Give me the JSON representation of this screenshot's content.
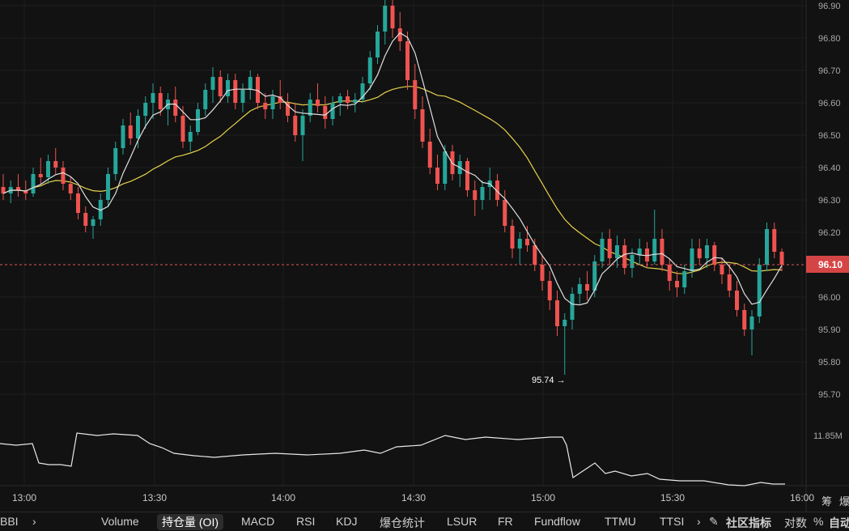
{
  "chart_data": {
    "type": "candlestick",
    "price_axis_ticks": [
      "96.90",
      "96.80",
      "96.70",
      "96.60",
      "96.50",
      "96.40",
      "96.30",
      "96.20",
      "96.00",
      "95.90",
      "95.80",
      "95.70"
    ],
    "current_price_label": "96.10",
    "current_price": 96.1,
    "low_marker_label": "95.74 →",
    "low_price": 95.74,
    "oi_axis_label": "11.85M",
    "time_ticks": [
      "13:00",
      "13:30",
      "14:00",
      "14:30",
      "15:00",
      "15:30",
      "16:00"
    ],
    "colors": {
      "up": "#26a69a",
      "down": "#ef5350",
      "ma_fast": "#e0e0e0",
      "ma_slow": "#e6d24c",
      "price_line": "#e05555"
    },
    "candles": [
      [
        96.34,
        96.38,
        96.3,
        96.32
      ],
      [
        96.32,
        96.36,
        96.29,
        96.34
      ],
      [
        96.34,
        96.38,
        96.31,
        96.33
      ],
      [
        96.33,
        96.36,
        96.3,
        96.32
      ],
      [
        96.32,
        96.4,
        96.31,
        96.38
      ],
      [
        96.38,
        96.43,
        96.35,
        96.37
      ],
      [
        96.37,
        96.44,
        96.35,
        96.42
      ],
      [
        96.42,
        96.46,
        96.38,
        96.4
      ],
      [
        96.4,
        96.42,
        96.33,
        96.35
      ],
      [
        96.35,
        96.37,
        96.3,
        96.32
      ],
      [
        96.32,
        96.34,
        96.24,
        96.26
      ],
      [
        96.26,
        96.28,
        96.2,
        96.22
      ],
      [
        96.22,
        96.25,
        96.18,
        96.24
      ],
      [
        96.24,
        96.32,
        96.22,
        96.3
      ],
      [
        96.3,
        96.4,
        96.28,
        96.38
      ],
      [
        96.38,
        96.48,
        96.36,
        96.46
      ],
      [
        96.46,
        96.55,
        96.44,
        96.53
      ],
      [
        96.53,
        96.57,
        96.47,
        96.49
      ],
      [
        96.49,
        96.58,
        96.46,
        96.56
      ],
      [
        96.56,
        96.62,
        96.52,
        96.6
      ],
      [
        96.6,
        96.66,
        96.55,
        96.63
      ],
      [
        96.63,
        96.65,
        96.56,
        96.58
      ],
      [
        96.58,
        96.63,
        96.53,
        96.61
      ],
      [
        96.61,
        96.65,
        96.54,
        96.56
      ],
      [
        96.56,
        96.59,
        96.46,
        96.48
      ],
      [
        96.48,
        96.53,
        96.45,
        96.51
      ],
      [
        96.51,
        96.6,
        96.5,
        96.58
      ],
      [
        96.58,
        96.66,
        96.56,
        96.64
      ],
      [
        96.64,
        96.71,
        96.6,
        96.68
      ],
      [
        96.68,
        96.7,
        96.6,
        96.62
      ],
      [
        96.62,
        96.69,
        96.6,
        96.67
      ],
      [
        96.67,
        96.69,
        96.58,
        96.6
      ],
      [
        96.6,
        96.66,
        96.57,
        96.64
      ],
      [
        96.64,
        96.7,
        96.61,
        96.68
      ],
      [
        96.68,
        96.69,
        96.58,
        96.6
      ],
      [
        96.6,
        96.63,
        96.55,
        96.58
      ],
      [
        96.58,
        96.64,
        96.55,
        96.62
      ],
      [
        96.62,
        96.67,
        96.58,
        96.6
      ],
      [
        96.6,
        96.63,
        96.54,
        96.56
      ],
      [
        96.56,
        96.6,
        96.48,
        96.5
      ],
      [
        96.5,
        96.58,
        96.42,
        96.56
      ],
      [
        96.56,
        96.63,
        96.54,
        96.61
      ],
      [
        96.61,
        96.66,
        96.57,
        96.59
      ],
      [
        96.59,
        96.62,
        96.52,
        96.55
      ],
      [
        96.55,
        96.62,
        96.53,
        96.6
      ],
      [
        96.6,
        96.63,
        96.56,
        96.62
      ],
      [
        96.62,
        96.64,
        96.58,
        96.6
      ],
      [
        96.6,
        96.63,
        96.57,
        96.61
      ],
      [
        96.61,
        96.68,
        96.6,
        96.66
      ],
      [
        96.66,
        96.76,
        96.64,
        96.74
      ],
      [
        96.74,
        96.84,
        96.72,
        96.82
      ],
      [
        96.82,
        96.94,
        96.78,
        96.9
      ],
      [
        96.9,
        96.93,
        96.8,
        96.83
      ],
      [
        96.83,
        96.88,
        96.76,
        96.79
      ],
      [
        96.79,
        96.82,
        96.64,
        96.67
      ],
      [
        96.67,
        96.72,
        96.55,
        96.58
      ],
      [
        96.58,
        96.62,
        96.46,
        96.48
      ],
      [
        96.48,
        96.52,
        96.38,
        96.4
      ],
      [
        96.4,
        96.44,
        96.33,
        96.35
      ],
      [
        96.35,
        96.47,
        96.33,
        96.45
      ],
      [
        96.45,
        96.47,
        96.36,
        96.38
      ],
      [
        96.38,
        96.44,
        96.34,
        96.42
      ],
      [
        96.42,
        96.43,
        96.31,
        96.33
      ],
      [
        96.33,
        96.36,
        96.25,
        96.3
      ],
      [
        96.3,
        96.36,
        96.27,
        96.34
      ],
      [
        96.34,
        96.4,
        96.3,
        96.36
      ],
      [
        96.36,
        96.38,
        96.28,
        96.3
      ],
      [
        96.3,
        96.33,
        96.2,
        96.22
      ],
      [
        96.22,
        96.24,
        96.12,
        96.15
      ],
      [
        96.15,
        96.2,
        96.1,
        96.18
      ],
      [
        96.18,
        96.22,
        96.14,
        96.16
      ],
      [
        96.16,
        96.18,
        96.08,
        96.1
      ],
      [
        96.1,
        96.13,
        96.02,
        96.05
      ],
      [
        96.05,
        96.08,
        95.96,
        95.99
      ],
      [
        95.99,
        96.02,
        95.88,
        95.91
      ],
      [
        95.91,
        95.95,
        95.76,
        95.93
      ],
      [
        95.93,
        96.03,
        95.9,
        96.01
      ],
      [
        96.01,
        96.06,
        95.98,
        96.04
      ],
      [
        96.04,
        96.08,
        95.99,
        96.02
      ],
      [
        96.02,
        96.13,
        96.0,
        96.11
      ],
      [
        96.11,
        96.2,
        96.09,
        96.18
      ],
      [
        96.18,
        96.21,
        96.1,
        96.12
      ],
      [
        96.12,
        96.19,
        96.09,
        96.16
      ],
      [
        96.16,
        96.18,
        96.07,
        96.09
      ],
      [
        96.09,
        96.15,
        96.06,
        96.13
      ],
      [
        96.13,
        96.18,
        96.1,
        96.15
      ],
      [
        96.15,
        96.17,
        96.09,
        96.11
      ],
      [
        96.11,
        96.27,
        96.1,
        96.18
      ],
      [
        96.18,
        96.21,
        96.08,
        96.1
      ],
      [
        96.1,
        96.12,
        96.02,
        96.05
      ],
      [
        96.05,
        96.08,
        96.0,
        96.03
      ],
      [
        96.03,
        96.1,
        96.01,
        96.08
      ],
      [
        96.08,
        96.18,
        96.06,
        96.15
      ],
      [
        96.15,
        96.18,
        96.1,
        96.12
      ],
      [
        96.12,
        96.18,
        96.09,
        96.16
      ],
      [
        96.16,
        96.17,
        96.08,
        96.1
      ],
      [
        96.1,
        96.12,
        96.04,
        96.07
      ],
      [
        96.07,
        96.1,
        96.0,
        96.02
      ],
      [
        96.02,
        96.05,
        95.94,
        95.96
      ],
      [
        95.96,
        95.98,
        95.88,
        95.9
      ],
      [
        95.9,
        95.96,
        95.82,
        95.94
      ],
      [
        95.94,
        96.12,
        95.92,
        96.1
      ],
      [
        96.1,
        96.23,
        96.08,
        96.21
      ],
      [
        96.21,
        96.23,
        96.12,
        96.14
      ],
      [
        96.14,
        96.15,
        96.08,
        96.1
      ]
    ]
  },
  "tabs": {
    "left_partial": "BBI",
    "chevron_left": "›",
    "items": [
      "Volume",
      "持仓量 (OI)",
      "MACD",
      "RSI",
      "KDJ",
      "爆仓统计",
      "LSUR",
      "FR",
      "Fundflow",
      "TTMU",
      "TTSI"
    ],
    "chevron_right": "›",
    "edit_icon": "✎",
    "community": "社区指标",
    "log_label": "对数",
    "pct_label": "%",
    "auto_label": "自动"
  },
  "right_glyphs": [
    "筹",
    "爆"
  ]
}
